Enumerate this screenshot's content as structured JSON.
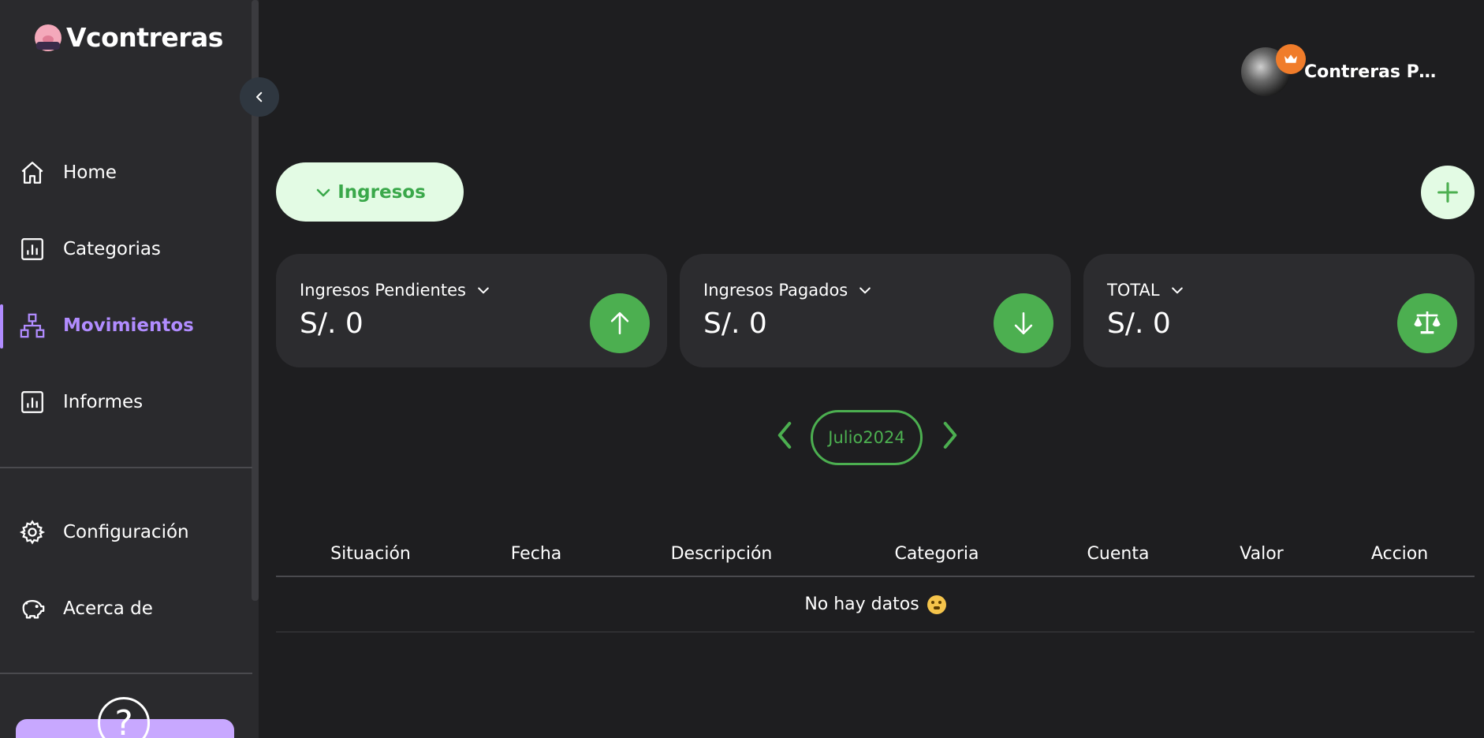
{
  "app": {
    "brand": "Vcontreras"
  },
  "sidebar": {
    "items": [
      {
        "label": "Home",
        "icon": "home-icon"
      },
      {
        "label": "Categorias",
        "icon": "bar-chart-icon"
      },
      {
        "label": "Movimientos",
        "icon": "hierarchy-icon",
        "active": true
      },
      {
        "label": "Informes",
        "icon": "report-icon"
      }
    ],
    "secondary": [
      {
        "label": "Configuración",
        "icon": "gear-icon"
      },
      {
        "label": "Acerca de",
        "icon": "piggy-bank-icon"
      }
    ],
    "help_symbol": "?"
  },
  "header": {
    "user_name": "Contreras Pari..."
  },
  "toolbar": {
    "type_label": "Ingresos"
  },
  "cards": [
    {
      "title": "Ingresos Pendientes",
      "value": "S/. 0",
      "icon": "arrow-up-icon"
    },
    {
      "title": "Ingresos Pagados",
      "value": "S/. 0",
      "icon": "arrow-down-icon"
    },
    {
      "title": "TOTAL",
      "value": "S/. 0",
      "icon": "balance-scale-icon"
    }
  ],
  "period": {
    "label": "Julio2024"
  },
  "table": {
    "columns": [
      "Situación",
      "Fecha",
      "Descripción",
      "Categoria",
      "Cuenta",
      "Valor",
      "Accion"
    ],
    "empty_text": "No hay datos"
  },
  "colors": {
    "accent_purple": "#b18cff",
    "accent_green": "#4caf50",
    "light_green": "#e3fbe4",
    "background": "#1e1e20",
    "sidebar": "#2a2a2d",
    "card": "#2c2c2f"
  }
}
